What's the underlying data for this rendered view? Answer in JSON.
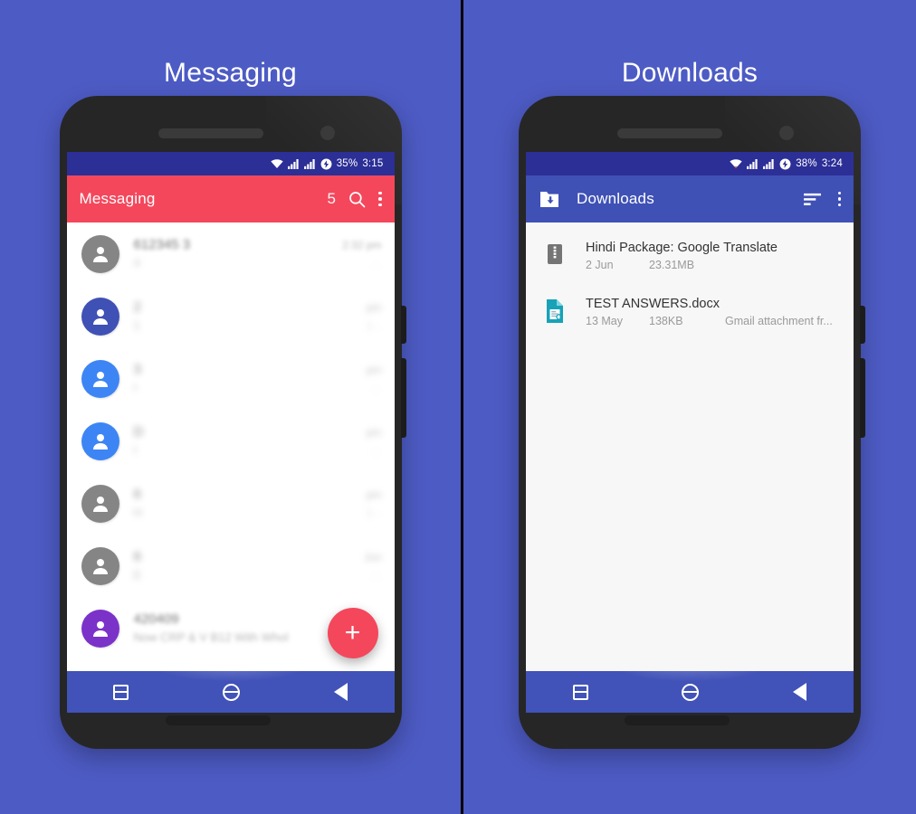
{
  "background_color": "#4d5bc4",
  "panels": [
    {
      "title": "Messaging",
      "status_bar": {
        "battery_percent": "35%",
        "time": "3:15",
        "wifi_icon": "wifi-icon",
        "signal_icon": "signal-bars-icon",
        "battery_icon": "battery-charging-icon"
      },
      "app_bar": {
        "title": "Messaging",
        "unread_count": "5",
        "search_icon": "search-icon",
        "overflow_icon": "overflow-menu-icon",
        "color": "#f4475c"
      },
      "messages": [
        {
          "name": "612345 3",
          "preview": "4",
          "time": "2:32 pm",
          "sub": "…",
          "avatar_color": "#858585",
          "blurred": false
        },
        {
          "name": "2",
          "preview": "1",
          "time": "pm",
          "sub": ")…",
          "avatar_color": "#3f51b5",
          "blurred": true
        },
        {
          "name": "3",
          "preview": "I",
          "time": "pm",
          "sub": "…",
          "avatar_color": "#3d85f5",
          "blurred": true
        },
        {
          "name": "D",
          "preview": "I",
          "time": "pm",
          "sub": "…",
          "avatar_color": "#3d85f5",
          "blurred": true
        },
        {
          "name": "6",
          "preview": "H",
          "time": "pm",
          "sub": ")…",
          "avatar_color": "#858585",
          "blurred": true
        },
        {
          "name": "6",
          "preview": "E",
          "time": "Jun",
          "sub": "…",
          "avatar_color": "#858585",
          "blurred": true
        },
        {
          "name": "420409",
          "preview": "Now CRP & V            B12 With Whol",
          "time": "",
          "sub": "",
          "avatar_color": "#7b32c9",
          "blurred": false
        }
      ],
      "fab": {
        "label": "+",
        "color": "#f4475c",
        "name": "new-message-fab"
      },
      "nav_bar": {
        "recents": "recents-button",
        "home": "home-button",
        "back": "back-button"
      }
    },
    {
      "title": "Downloads",
      "status_bar": {
        "battery_percent": "38%",
        "time": "3:24",
        "wifi_icon": "wifi-icon",
        "signal_icon": "signal-bars-icon",
        "battery_icon": "battery-charging-icon"
      },
      "app_bar": {
        "title": "Downloads",
        "folder_icon": "folder-download-icon",
        "sort_icon": "sort-icon",
        "overflow_icon": "overflow-menu-icon",
        "color": "#3f51b5"
      },
      "downloads": [
        {
          "title": "Hindi Package: Google Translate",
          "date": "2 Jun",
          "size": "23.31MB",
          "source": "",
          "icon": "archive-file-icon",
          "icon_color": "#757575"
        },
        {
          "title": "TEST ANSWERS.docx",
          "date": "13 May",
          "size": "138KB",
          "source": "Gmail attachment fr...",
          "icon": "document-file-icon",
          "icon_color": "#17a2b8"
        }
      ],
      "nav_bar": {
        "recents": "recents-button",
        "home": "home-button",
        "back": "back-button"
      }
    }
  ]
}
